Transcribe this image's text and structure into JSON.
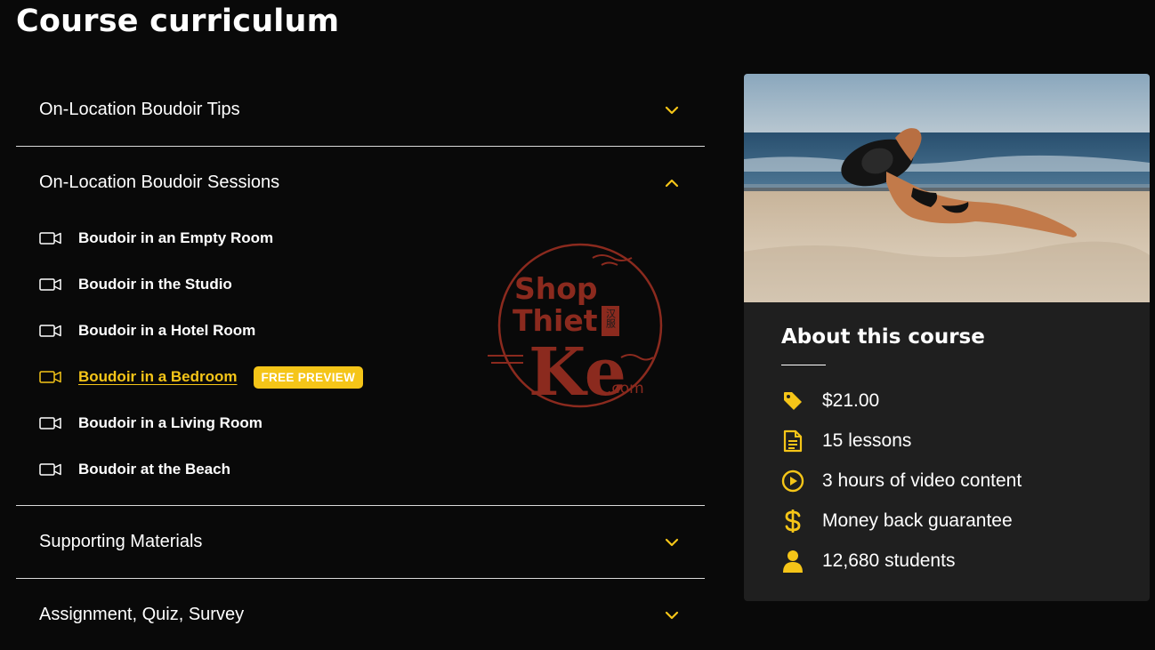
{
  "page": {
    "title": "Course curriculum"
  },
  "colors": {
    "background": "#090909",
    "card": "#1f1f1f",
    "accent": "#f5c518",
    "divider": "#d9d9d9",
    "watermark": "#8b2a1e"
  },
  "sections": [
    {
      "title": "On-Location Boudoir Tips",
      "expanded": false,
      "icon": "chevron-down-icon"
    },
    {
      "title": "On-Location Boudoir Sessions",
      "expanded": true,
      "icon": "chevron-up-icon",
      "lessons": [
        {
          "label": "Boudoir in an Empty Room",
          "icon": "video-camera-icon"
        },
        {
          "label": "Boudoir in the Studio",
          "icon": "video-camera-icon"
        },
        {
          "label": "Boudoir in a Hotel Room",
          "icon": "video-camera-icon"
        },
        {
          "label": "Boudoir in a Bedroom",
          "icon": "video-camera-icon",
          "active": true,
          "badge": "FREE PREVIEW"
        },
        {
          "label": "Boudoir in a Living Room",
          "icon": "video-camera-icon"
        },
        {
          "label": "Boudoir at the Beach",
          "icon": "video-camera-icon"
        }
      ]
    },
    {
      "title": "Supporting Materials",
      "expanded": false,
      "icon": "chevron-down-icon"
    },
    {
      "title": "Assignment, Quiz, Survey",
      "expanded": false,
      "icon": "chevron-down-icon"
    }
  ],
  "about": {
    "title": "About this course",
    "features": [
      {
        "icon": "price-tag-icon",
        "text": "$21.00"
      },
      {
        "icon": "document-icon",
        "text": "15 lessons"
      },
      {
        "icon": "play-circle-icon",
        "text": "3 hours of video content"
      },
      {
        "icon": "dollar-icon",
        "text": "Money back guarantee"
      },
      {
        "icon": "user-icon",
        "text": "12,680 students"
      }
    ]
  },
  "watermark": {
    "line1": "Shop",
    "line2": "Thiet",
    "line3": "Ke",
    "suffix": ".com",
    "cjk": "汉服"
  }
}
